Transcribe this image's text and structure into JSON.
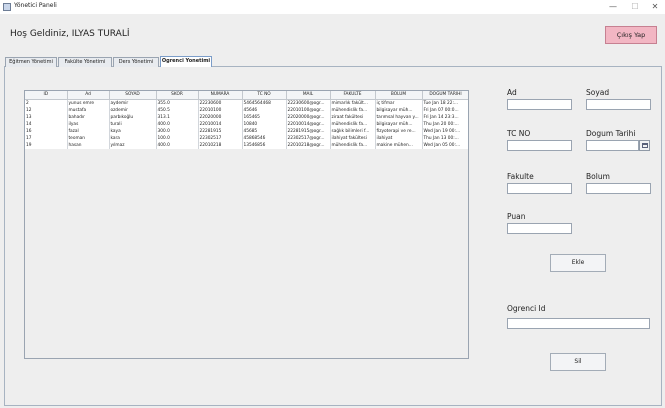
{
  "window": {
    "title": "Yönetici Paneli"
  },
  "header": {
    "welcome": "Hoş Geldiniz, ILYAS TURALİ",
    "logout_label": "Çıkış Yap"
  },
  "tabs": [
    {
      "label": "Eğitmen Yönetimi"
    },
    {
      "label": "Fakülte Yönetimi"
    },
    {
      "label": "Ders Yönetimi"
    },
    {
      "label": "Ogrenci Yonetimi"
    }
  ],
  "table": {
    "columns": [
      "ID",
      "Ad",
      "SOYAD",
      "SKOR",
      "NUMARA",
      "TC NO",
      "MAIL",
      "FAKULTE",
      "BOLUM",
      "DOGUM TARIHI"
    ],
    "rows": [
      [
        "2",
        "yunus emre",
        "aydemir",
        "355.0",
        "22230600",
        "5464564468",
        "22230600@ogr...",
        "mimarlık fakült...",
        "iç tifmar",
        "Tue Jan 18 22:..."
      ],
      [
        "12",
        "mustafa",
        "ozdemir",
        "450.5",
        "22010100",
        "45646",
        "22010100@ogr...",
        "mühendislik fa...",
        "bilgisayar müh...",
        "Fri Jan 07 00:0..."
      ],
      [
        "13",
        "bahadır",
        "parbıkoğlu",
        "313.1",
        "22020000",
        "165465",
        "22020000@ogr...",
        "ziraat fakültesi",
        "tarımsal hayvan y...",
        "Fri Jan 14 23:3..."
      ],
      [
        "14",
        "ilyas",
        "turali",
        "400.0",
        "22010014",
        "10840",
        "22010014@ogr...",
        "mühendislik fa...",
        "bilgisayar müh...",
        "Thu Jan 20 00:..."
      ],
      [
        "16",
        "fazal",
        "kaya",
        "300.0",
        "22281915",
        "45685",
        "22281915@ogr...",
        "sağlık bilimleri f...",
        "fizyoterapi ve re...",
        "Wed Jan 19 00:..."
      ],
      [
        "17",
        "teoman",
        "kara",
        "100.0",
        "22302517",
        "45868546",
        "22302517@ogr...",
        "ilahiyat fakültesi",
        "ilahiyat",
        "Thu Jan 13 00:..."
      ],
      [
        "19",
        "hasan",
        "yılmaz",
        "400.0",
        "22010218",
        "13546856",
        "22010218@ogr...",
        "mühendislik fa...",
        "makine mühen...",
        "Wed Jan 05 00:..."
      ]
    ]
  },
  "form": {
    "ad_label": "Ad",
    "soyad_label": "Soyad",
    "tcno_label": "TC NO",
    "dogum_tarihi_label": "Dogum Tarihi",
    "fakulte_label": "Fakulte",
    "bolum_label": "Bolum",
    "puan_label": "Puan",
    "ekle_label": "Ekle",
    "ogrenci_id_label": "Ogrenci Id",
    "sil_label": "Sil"
  },
  "icons": {
    "calendar": "calendar-icon",
    "app": "window-icon"
  }
}
